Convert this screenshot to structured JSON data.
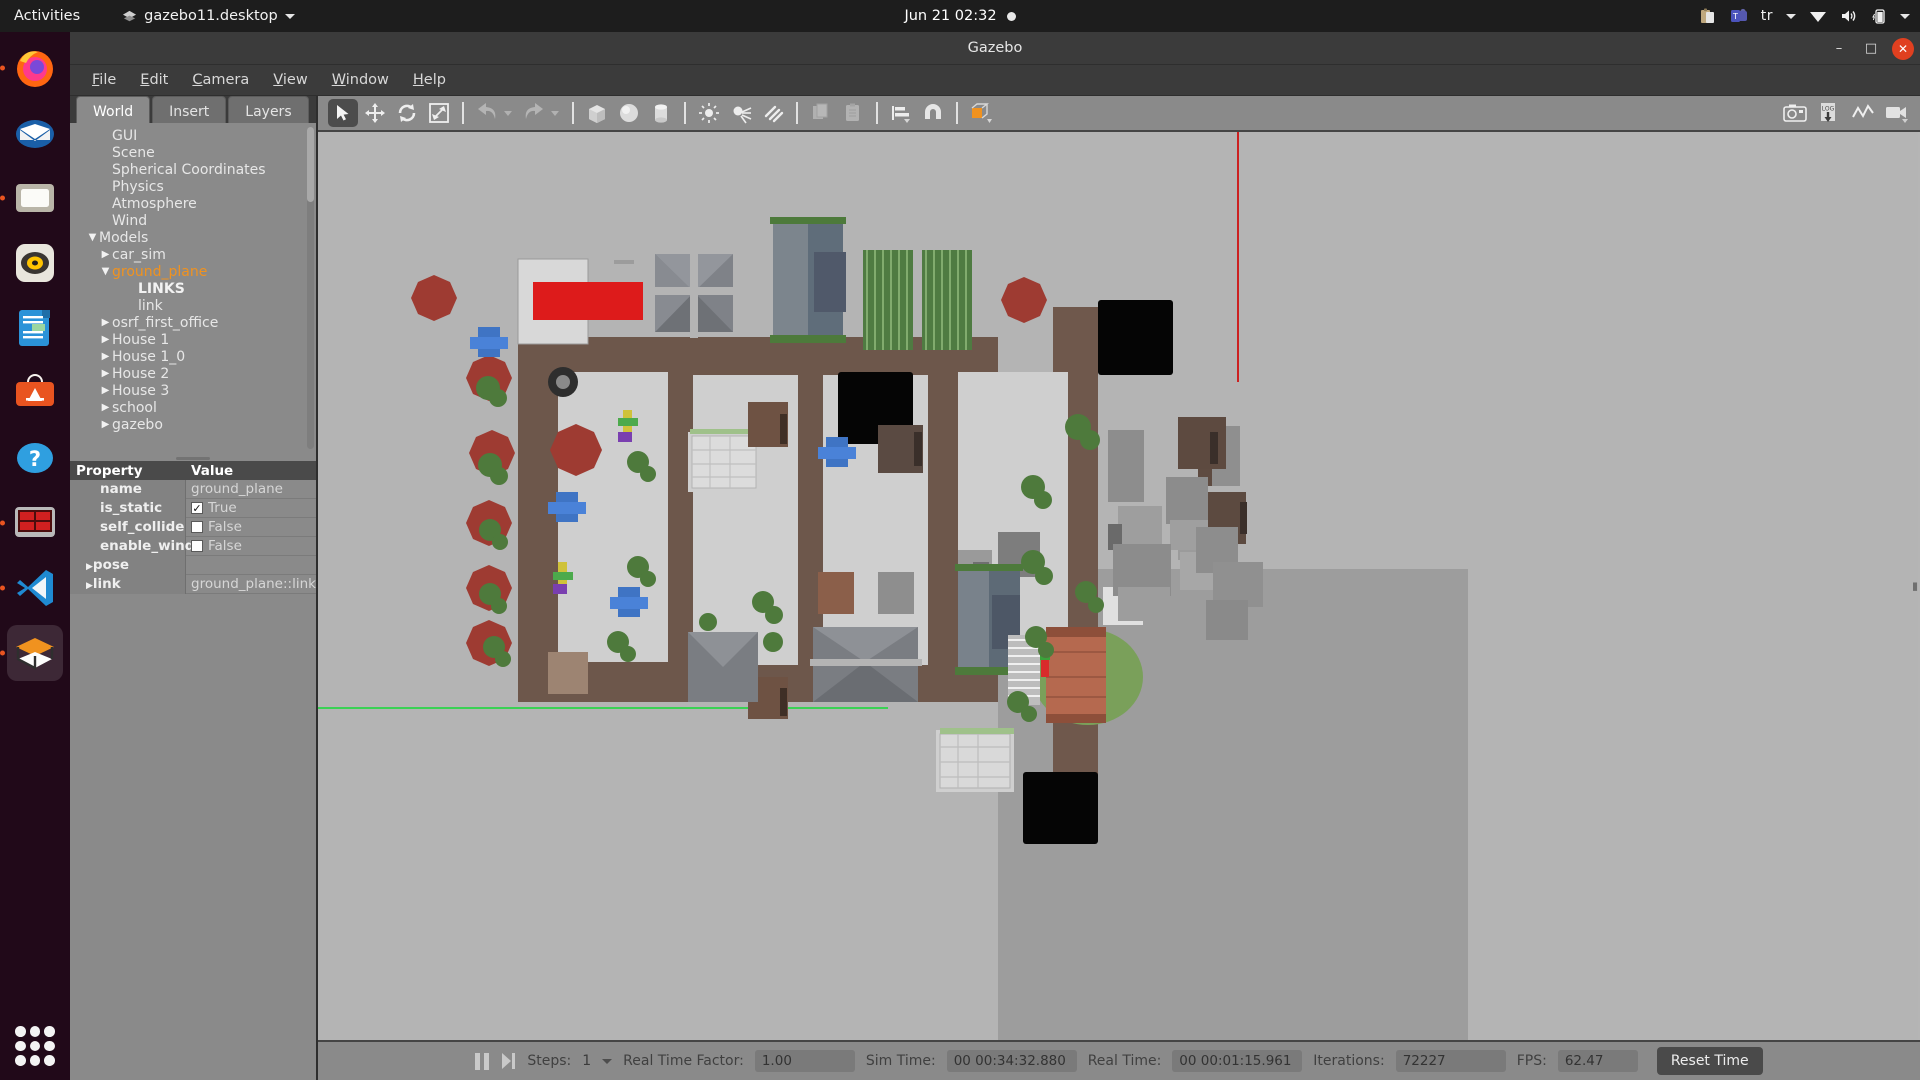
{
  "topbar": {
    "activities": "Activities",
    "app_name": "gazebo11.desktop",
    "clock": "Jun 21  02:32",
    "keyboard_layout": "tr",
    "tray_icons": [
      "clipboard-icon",
      "teams-icon",
      "keyboard-layout",
      "wifi-icon",
      "volume-icon",
      "battery-icon",
      "system-menu-arrow"
    ]
  },
  "dock": {
    "items": [
      {
        "name": "firefox",
        "running": true
      },
      {
        "name": "thunderbird",
        "running": false
      },
      {
        "name": "files",
        "running": true
      },
      {
        "name": "rhythmbox",
        "running": false
      },
      {
        "name": "libreoffice-writer",
        "running": false
      },
      {
        "name": "ubuntu-software",
        "running": false
      },
      {
        "name": "help",
        "running": false
      },
      {
        "name": "remmina",
        "running": true
      },
      {
        "name": "vscode",
        "running": true
      },
      {
        "name": "gazebo",
        "running": true,
        "active": true
      }
    ],
    "show_apps": "show-applications"
  },
  "window": {
    "title": "Gazebo",
    "minimize": "–",
    "maximize": "□",
    "close": "✕"
  },
  "menubar": {
    "items": [
      {
        "label": "File",
        "mnemonic": "F"
      },
      {
        "label": "Edit",
        "mnemonic": "E"
      },
      {
        "label": "Camera",
        "mnemonic": "C"
      },
      {
        "label": "View",
        "mnemonic": "V"
      },
      {
        "label": "Window",
        "mnemonic": "W"
      },
      {
        "label": "Help",
        "mnemonic": "H"
      }
    ]
  },
  "left_panel": {
    "tabs": [
      {
        "label": "World",
        "active": true
      },
      {
        "label": "Insert",
        "active": false
      },
      {
        "label": "Layers",
        "active": false
      }
    ],
    "tree": [
      {
        "label": "GUI",
        "indent": 1,
        "arrow": "",
        "style": ""
      },
      {
        "label": "Scene",
        "indent": 1,
        "arrow": "",
        "style": ""
      },
      {
        "label": "Spherical Coordinates",
        "indent": 1,
        "arrow": "",
        "style": ""
      },
      {
        "label": "Physics",
        "indent": 1,
        "arrow": "",
        "style": ""
      },
      {
        "label": "Atmosphere",
        "indent": 1,
        "arrow": "",
        "style": ""
      },
      {
        "label": "Wind",
        "indent": 1,
        "arrow": "",
        "style": ""
      },
      {
        "label": "Models",
        "indent": 0,
        "arrow": "down",
        "style": ""
      },
      {
        "label": "car_sim",
        "indent": 1,
        "arrow": "right",
        "style": ""
      },
      {
        "label": "ground_plane",
        "indent": 1,
        "arrow": "down",
        "style": "selected"
      },
      {
        "label": "LINKS",
        "indent": 3,
        "arrow": "",
        "style": "bold"
      },
      {
        "label": "link",
        "indent": 3,
        "arrow": "",
        "style": ""
      },
      {
        "label": "osrf_first_office",
        "indent": 1,
        "arrow": "right",
        "style": ""
      },
      {
        "label": "House 1",
        "indent": 1,
        "arrow": "right",
        "style": ""
      },
      {
        "label": "House 1_0",
        "indent": 1,
        "arrow": "right",
        "style": ""
      },
      {
        "label": "House 2",
        "indent": 1,
        "arrow": "right",
        "style": ""
      },
      {
        "label": "House 3",
        "indent": 1,
        "arrow": "right",
        "style": ""
      },
      {
        "label": "school",
        "indent": 1,
        "arrow": "right",
        "style": ""
      },
      {
        "label": "gazebo",
        "indent": 1,
        "arrow": "right",
        "style": ""
      }
    ],
    "property_header": {
      "property": "Property",
      "value": "Value"
    },
    "properties": [
      {
        "name": "name",
        "value": "ground_plane",
        "kind": "text",
        "arrow": ""
      },
      {
        "name": "is_static",
        "value": "True",
        "kind": "checkbox",
        "checked": true,
        "arrow": ""
      },
      {
        "name": "self_collide",
        "value": "False",
        "kind": "checkbox",
        "checked": false,
        "arrow": ""
      },
      {
        "name": "enable_wind",
        "value": "False",
        "kind": "checkbox",
        "checked": false,
        "arrow": ""
      },
      {
        "name": "pose",
        "value": "",
        "kind": "group",
        "arrow": "right"
      },
      {
        "name": "link",
        "value": "ground_plane::link",
        "kind": "group",
        "arrow": "right"
      }
    ]
  },
  "toolbar": {
    "left_tools": [
      {
        "name": "select-mode",
        "icon": "cursor-arrow-icon",
        "active": true,
        "dim": false
      },
      {
        "name": "translate-mode",
        "icon": "move-icon",
        "active": false,
        "dim": false
      },
      {
        "name": "rotate-mode",
        "icon": "rotate-icon",
        "active": false,
        "dim": false
      },
      {
        "name": "scale-mode",
        "icon": "scale-icon",
        "active": false,
        "dim": false
      },
      {
        "name": "separator",
        "icon": "separator",
        "active": false,
        "dim": false
      },
      {
        "name": "undo-button",
        "icon": "undo-icon",
        "active": false,
        "dim": true
      },
      {
        "name": "undo-history-dropdown",
        "icon": "caret-down-icon",
        "active": false,
        "dim": true
      },
      {
        "name": "redo-button",
        "icon": "redo-icon",
        "active": false,
        "dim": true
      },
      {
        "name": "redo-history-dropdown",
        "icon": "caret-down-icon",
        "active": false,
        "dim": true
      },
      {
        "name": "separator",
        "icon": "separator",
        "active": false,
        "dim": false
      },
      {
        "name": "insert-box",
        "icon": "box-icon",
        "active": false,
        "dim": false
      },
      {
        "name": "insert-sphere",
        "icon": "sphere-icon",
        "active": false,
        "dim": false
      },
      {
        "name": "insert-cylinder",
        "icon": "cylinder-icon",
        "active": false,
        "dim": false
      },
      {
        "name": "separator",
        "icon": "separator",
        "active": false,
        "dim": false
      },
      {
        "name": "insert-point-light",
        "icon": "point-light-icon",
        "active": false,
        "dim": false
      },
      {
        "name": "insert-spot-light",
        "icon": "spot-light-icon",
        "active": false,
        "dim": false
      },
      {
        "name": "insert-directional-light",
        "icon": "directional-light-icon",
        "active": false,
        "dim": false
      },
      {
        "name": "separator",
        "icon": "separator",
        "active": false,
        "dim": false
      },
      {
        "name": "copy-button",
        "icon": "copy-icon",
        "active": false,
        "dim": true
      },
      {
        "name": "paste-button",
        "icon": "paste-icon",
        "active": false,
        "dim": true
      },
      {
        "name": "separator",
        "icon": "separator",
        "active": false,
        "dim": false
      },
      {
        "name": "align-button",
        "icon": "align-icon",
        "active": false,
        "dim": false
      },
      {
        "name": "snap-button",
        "icon": "magnet-icon",
        "active": false,
        "dim": false
      },
      {
        "name": "separator",
        "icon": "separator",
        "active": false,
        "dim": false
      },
      {
        "name": "view-mode-button",
        "icon": "orange-cube-icon",
        "active": false,
        "dim": false
      }
    ],
    "right_tools": [
      {
        "name": "screenshot-button",
        "icon": "camera-icon"
      },
      {
        "name": "log-button",
        "icon": "log-download-icon"
      },
      {
        "name": "plot-button",
        "icon": "plot-line-icon"
      },
      {
        "name": "video-record-button",
        "icon": "video-camera-icon"
      }
    ]
  },
  "statusbar": {
    "pause": "pause-button",
    "step": "step-button",
    "steps_label": "Steps:",
    "steps_value": "1",
    "rtf_label": "Real Time Factor:",
    "rtf_value": "1.00",
    "sim_time_label": "Sim Time:",
    "sim_time_value": "00 00:34:32.880",
    "real_time_label": "Real Time:",
    "real_time_value": "00 00:01:15.961",
    "iterations_label": "Iterations:",
    "iterations_value": "72227",
    "fps_label": "FPS:",
    "fps_value": "62.47",
    "reset_button": "Reset Time"
  },
  "viewport": {
    "description": "Top-down 3D view of Gazebo world with houses, school, office buildings, trees and a car",
    "ground_color": "#b4b4b4",
    "plaza_color": "#9c9c9c",
    "road_color": "#6b564a",
    "grass_color": "#6d8a4e",
    "red_axis_color": "#cc2020",
    "green_axis_color": "#2fcf4a"
  }
}
